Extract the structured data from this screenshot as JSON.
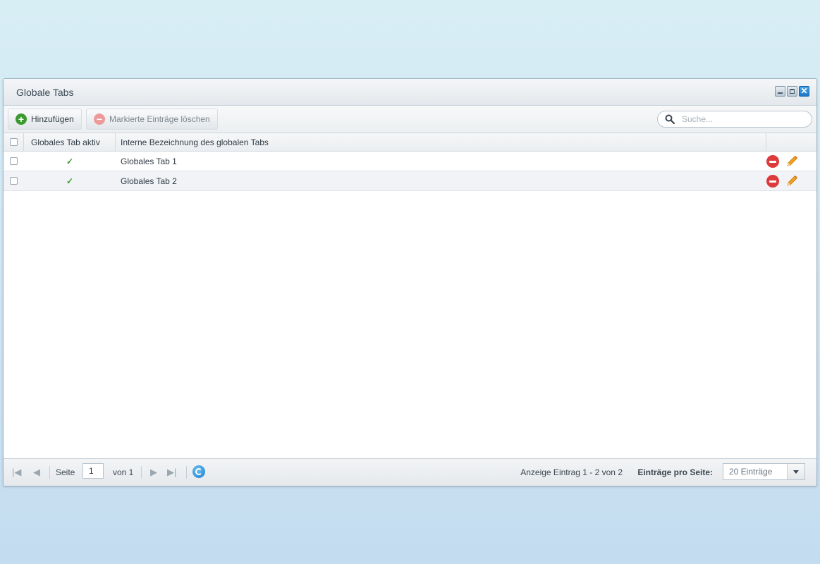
{
  "window": {
    "title": "Globale Tabs"
  },
  "toolbar": {
    "add_label": "Hinzufügen",
    "delete_label": "Markierte Einträge löschen",
    "search_placeholder": "Suche..."
  },
  "grid": {
    "columns": {
      "active": "Globales Tab aktiv",
      "name": "Interne Bezeichnung des globalen Tabs"
    },
    "rows": [
      {
        "active": "✓",
        "name": "Globales Tab 1"
      },
      {
        "active": "✓",
        "name": "Globales Tab 2"
      }
    ]
  },
  "pager": {
    "page_label": "Seite",
    "page_value": "1",
    "of_label": "von 1",
    "display_info": "Anzeige Eintrag 1 - 2 von 2",
    "per_page_label": "Einträge pro Seite:",
    "per_page_value": "20 Einträge"
  },
  "colors": {
    "accent": "#1b78c8",
    "add_green": "#3a9a2e",
    "delete_red": "#dd3b3b",
    "edit_orange": "#f0a020",
    "check_green": "#3c9a2a"
  }
}
